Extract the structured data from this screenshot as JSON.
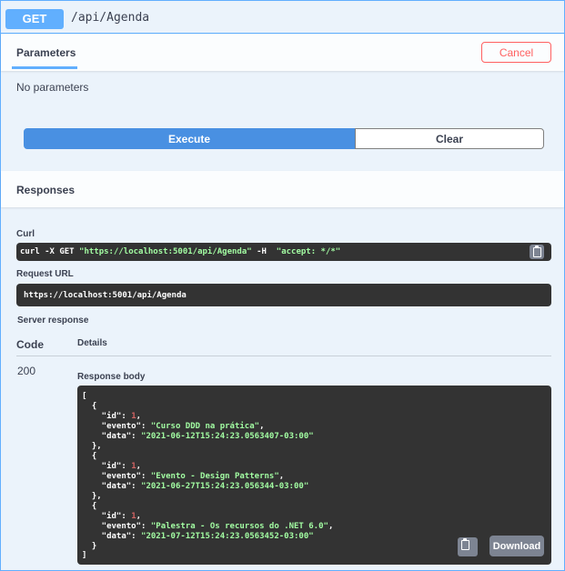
{
  "operation": {
    "method": "GET",
    "path": "/api/Agenda"
  },
  "parameters": {
    "tab_label": "Parameters",
    "cancel_label": "Cancel",
    "empty_text": "No parameters"
  },
  "actions": {
    "execute_label": "Execute",
    "clear_label": "Clear"
  },
  "responses": {
    "title": "Responses",
    "curl_label": "Curl",
    "curl": {
      "prefix": "curl -X GET ",
      "url": "\"https://localhost:5001/api/Agenda\"",
      "mid": " -H  ",
      "header": "\"accept: */*\""
    },
    "request_url_label": "Request URL",
    "request_url": "https://localhost:5001/api/Agenda",
    "server_response_label": "Server response",
    "columns": {
      "code": "Code",
      "details": "Details"
    },
    "code": "200",
    "body_label": "Response body",
    "download_label": "Download",
    "body_items": [
      {
        "id": "1",
        "evento": "\"Curso DDD na prática\"",
        "data": "\"2021-06-12T15:24:23.0563407-03:00\""
      },
      {
        "id": "1",
        "evento": "\"Evento - Design Patterns\"",
        "data": "\"2021-06-27T15:24:23.056344-03:00\""
      },
      {
        "id": "1",
        "evento": "\"Palestra - Os recursos do .NET 6.0\"",
        "data": "\"2021-07-12T15:24:23.0563452-03:00\""
      }
    ]
  },
  "colors": {
    "get_accent": "#61affe",
    "execute": "#4990e2",
    "cancel": "#ff6060",
    "code_bg": "#333333",
    "string": "#a2fca2",
    "number": "#d36363"
  },
  "icons": {
    "copy": "copy-icon"
  }
}
